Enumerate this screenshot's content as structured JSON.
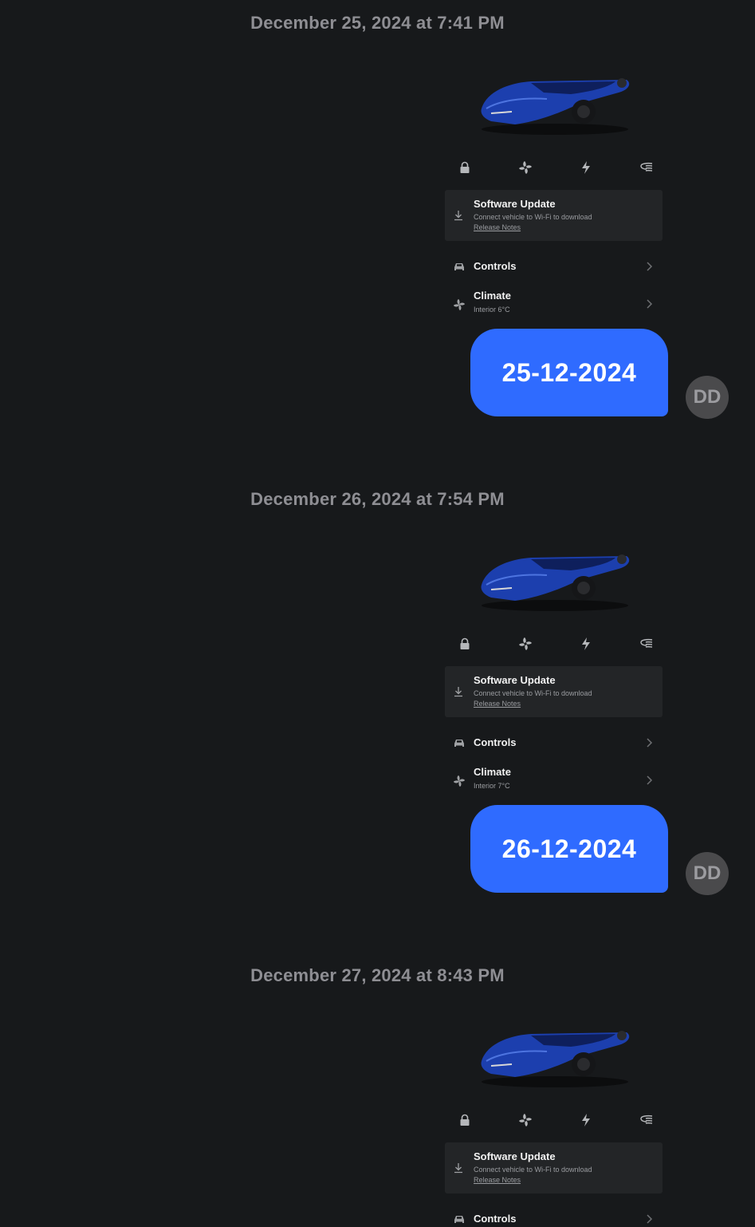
{
  "entries": [
    {
      "timestamp": "December 25, 2024 at 7:41 PM",
      "update": {
        "title": "Software Update",
        "subtitle": "Connect vehicle to Wi-Fi to download",
        "link": "Release Notes"
      },
      "controls_label": "Controls",
      "climate": {
        "label": "Climate",
        "subtitle": "Interior 6°C"
      },
      "message": "25-12-2024",
      "avatar": "DD"
    },
    {
      "timestamp": "December 26, 2024 at 7:54 PM",
      "update": {
        "title": "Software Update",
        "subtitle": "Connect vehicle to Wi-Fi to download",
        "link": "Release Notes"
      },
      "controls_label": "Controls",
      "climate": {
        "label": "Climate",
        "subtitle": "Interior 7°C"
      },
      "message": "26-12-2024",
      "avatar": "DD"
    },
    {
      "timestamp": "December 27, 2024 at 8:43 PM",
      "update": {
        "title": "Software Update",
        "subtitle": "Connect vehicle to Wi-Fi to download",
        "link": "Release Notes"
      },
      "controls_label": "Controls"
    }
  ],
  "icons": [
    "lock-icon",
    "fan-icon",
    "bolt-icon",
    "defrost-icon"
  ],
  "colors": {
    "background": "#17191b",
    "bubble": "#2f6bff",
    "car": "#1c3fae",
    "card": "#232527"
  }
}
